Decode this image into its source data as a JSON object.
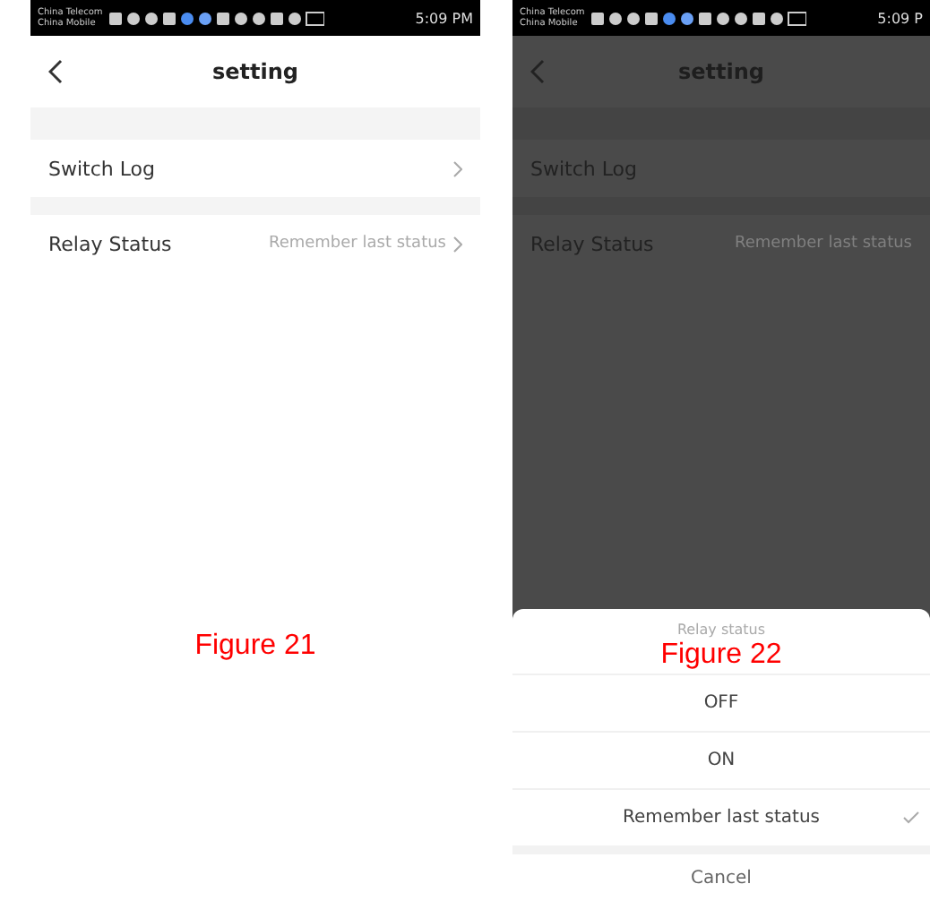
{
  "figures": [
    {
      "caption": "Figure 21",
      "dimmed": false,
      "status_bar": {
        "carrier_1": "China Telecom",
        "carrier_2": "China Mobile",
        "time": "5:09 PM"
      },
      "header": {
        "title": "setting"
      },
      "rows": [
        {
          "label": "Switch Log",
          "chevron": true
        },
        {
          "label": "Relay Status",
          "value": "Remember last status",
          "chevron": true
        }
      ]
    },
    {
      "caption": "Figure 22",
      "dimmed": true,
      "status_bar": {
        "carrier_1": "China Telecom",
        "carrier_2": "China Mobile",
        "time": "5:09 P"
      },
      "header": {
        "title": "setting"
      },
      "rows": [
        {
          "label": "Switch Log",
          "chevron": false
        },
        {
          "label": "Relay Status",
          "value": "Remember last status",
          "chevron": false
        }
      ],
      "sheet": {
        "title": "Relay status",
        "options": [
          {
            "label": "OFF",
            "selected": false
          },
          {
            "label": "ON",
            "selected": false
          },
          {
            "label": "Remember last status",
            "selected": true
          }
        ],
        "cancel": "Cancel"
      }
    }
  ]
}
